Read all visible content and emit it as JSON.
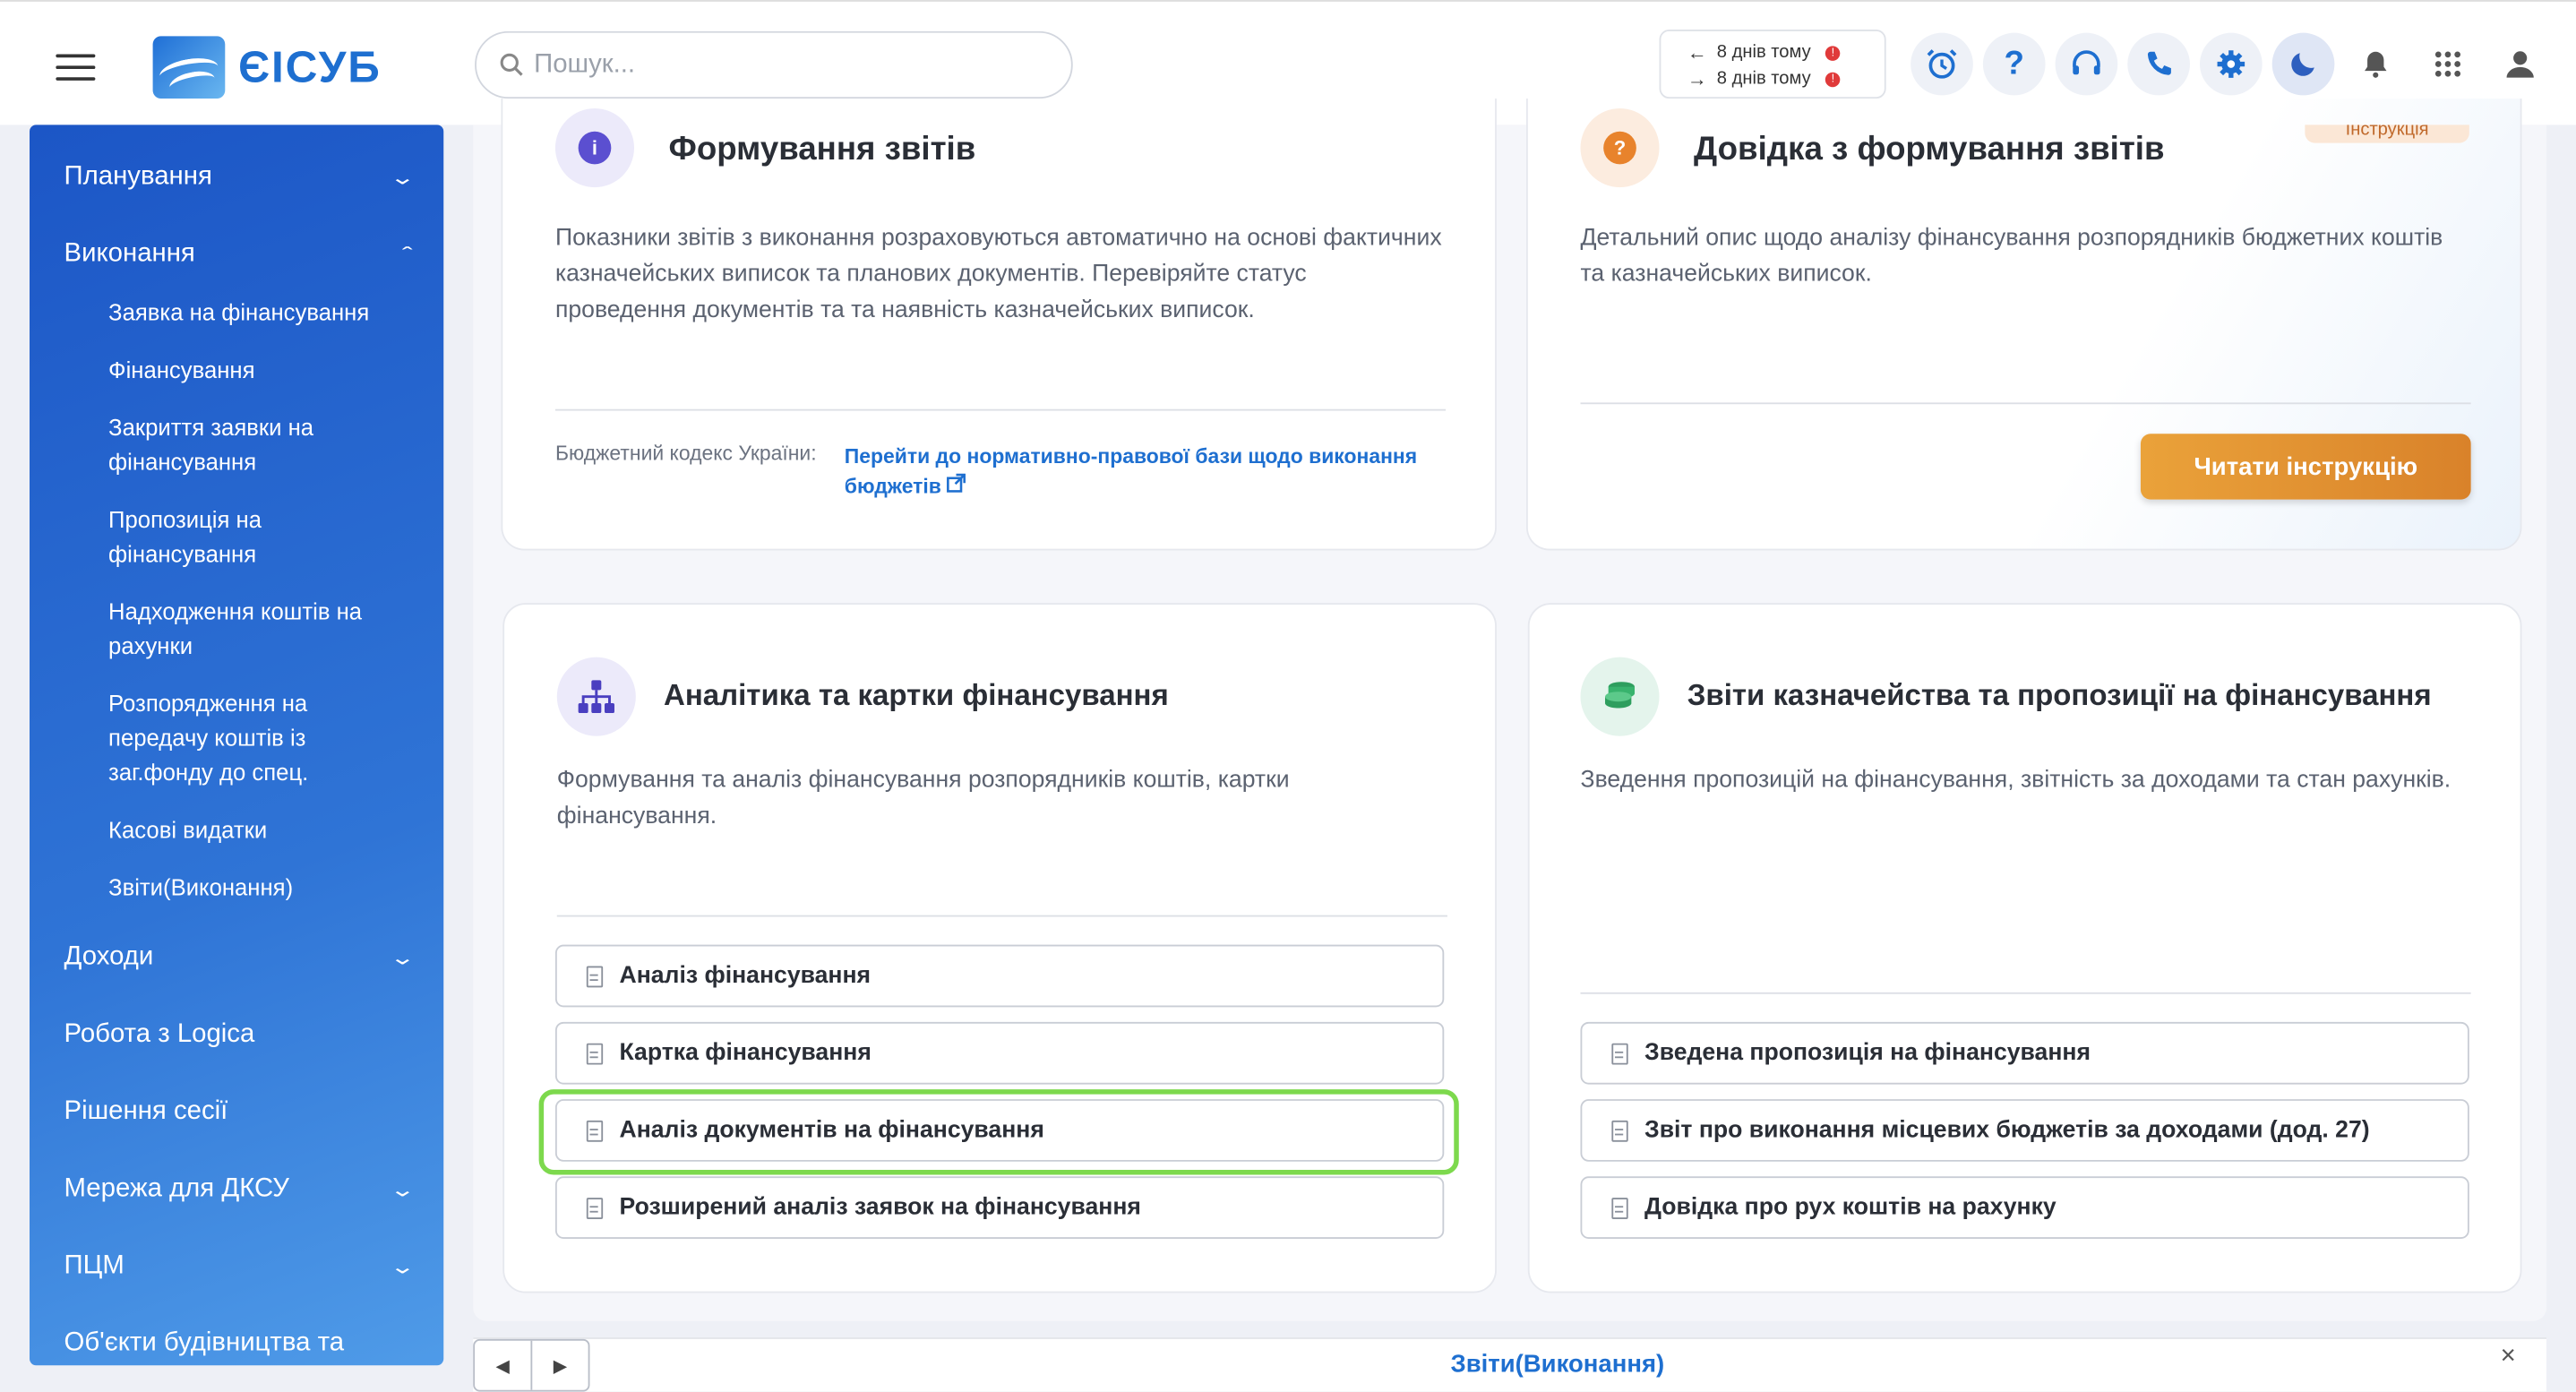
{
  "header": {
    "logo_text": "ЄІСУБ",
    "search_placeholder": "Пошук...",
    "history": [
      {
        "arrow": "←",
        "label": "8 днів тому",
        "badge": "!"
      },
      {
        "arrow": "→",
        "label": "8 днів тому",
        "badge": "!"
      }
    ],
    "icons": [
      "alarm-clock-icon",
      "help-icon",
      "headset-icon",
      "phone-icon",
      "gear-icon",
      "moon-icon",
      "bell-icon",
      "apps-grid-icon",
      "user-icon"
    ],
    "help_glyph": "?"
  },
  "sidebar": {
    "items": [
      {
        "label": "Планування",
        "chevron": "down"
      },
      {
        "label": "Виконання",
        "chevron": "up"
      },
      {
        "label": "Доходи",
        "chevron": "down"
      },
      {
        "label": "Робота з Logica",
        "chevron": ""
      },
      {
        "label": "Рішення сесії",
        "chevron": ""
      },
      {
        "label": "Мережа для ДКСУ",
        "chevron": "down"
      },
      {
        "label": "ПЦМ",
        "chevron": "down"
      },
      {
        "label": "Об'єкти будівництва та",
        "chevron": ""
      }
    ],
    "subitems": [
      "Заявка на фінансування",
      "Фінансування",
      "Закриття заявки на фінансування",
      "Пропозиція на фінансування",
      "Надходження коштів на рахунки",
      "Розпорядження на передачу коштів із заг.фонду до спец.",
      "Касові видатки",
      "Звіти(Виконання)"
    ]
  },
  "cards": {
    "forming": {
      "title": "Формування звітів",
      "icon_glyph": "i",
      "text": "Показники звітів з виконання розраховуються автоматично на основі фактичних казначейських виписок та планових документів. Перевіряйте статус проведення документів та та наявність казначейських виписок.",
      "footer_label": "Бюджетний кодекс України:",
      "footer_link": "Перейти до нормативно-правової бази щодо виконання бюджетів"
    },
    "help": {
      "title": "Довідка з формування звітів",
      "icon_glyph": "?",
      "tag": "Інструкція",
      "text": "Детальний опис щодо аналізу фінансування розпорядників бюджетних коштів та казначейських виписок.",
      "button": "Читати інструкцію"
    },
    "analytics": {
      "title": "Аналітика та картки фінансування",
      "text": "Формування та аналіз фінансування розпорядників коштів, картки фінансування.",
      "buttons": [
        "Аналіз фінансування",
        "Картка фінансування",
        "Аналіз документів на фінансування",
        "Розширений аналіз заявок на фінансування"
      ]
    },
    "treasury": {
      "title": "Звіти казначейства та пропозиції на фінансування",
      "text": "Зведення пропозицій на фінансування, звітність за доходами та стан рахунків.",
      "buttons": [
        "Зведена пропозиція на фінансування",
        "Звіт про виконання місцевих бюджетів за доходами (дод. 27)",
        "Довідка про рух коштів на рахунку"
      ]
    }
  },
  "bottom": {
    "tab": "Звіти(Виконання)",
    "prev": "◀",
    "next": "▶",
    "close": "×"
  }
}
